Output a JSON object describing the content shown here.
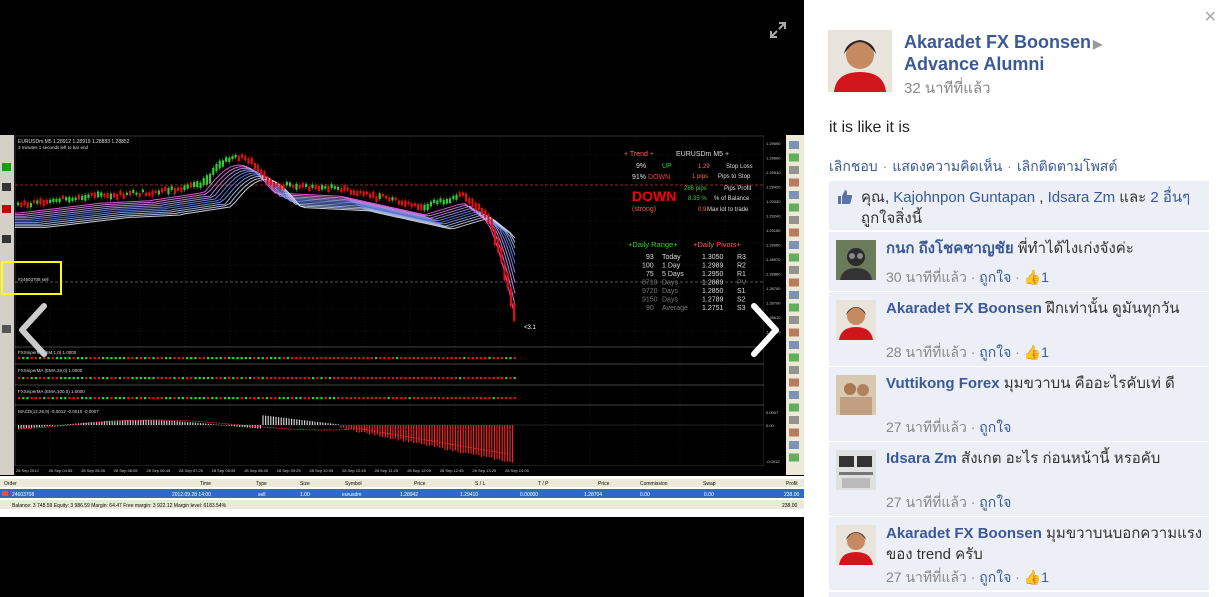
{
  "post": {
    "owner_name": "Akaradet FX Boonsen",
    "group_name": "Advance Alumni",
    "time": "32 นาทีที่แล้ว",
    "text": "it is like it is",
    "action_unlike": "เลิกชอบ",
    "action_comment": "แสดงความคิดเห็น",
    "action_unfollow": "เลิกติดตามโพสต์",
    "likes_prefix": "คุณ,",
    "like_user_1": "Kajohnpon Guntapan",
    "like_sep": ",",
    "like_user_2": "Idsara Zm",
    "likes_and": "และ",
    "likes_others": "2 อื่นๆ",
    "likes_suffix": "ถูกใจสิ่งนี้"
  },
  "comments": [
    {
      "name": "กนก ถึงโชคชาญชัย",
      "text": "พี่ทำได้ไงเก่งจังค่ะ",
      "time": "30 นาทีที่แล้ว",
      "like": "ถูกใจ",
      "count": "1"
    },
    {
      "name": "Akaradet FX Boonsen",
      "text": "ฝึกเท่านั้น ดูมันทุกวัน",
      "time": "28 นาทีที่แล้ว",
      "like": "ถูกใจ",
      "count": "1"
    },
    {
      "name": "Vuttikong Forex",
      "text": "มุมขวาบน คืออะไรคับเท่ ดี",
      "time": "27 นาทีที่แล้ว",
      "like": "ถูกใจ",
      "count": ""
    },
    {
      "name": "Idsara Zm",
      "text": "สังเกต อะไร ก่อนหน้านี้ หรอคับ",
      "time": "27 นาทีที่แล้ว",
      "like": "ถูกใจ",
      "count": ""
    },
    {
      "name": "Akaradet FX Boonsen",
      "text": "มุมขวาบนบอกความแรงของ trend ครับ",
      "time": "27 นาทีที่แล้ว",
      "like": "ถูกใจ",
      "count": "1"
    }
  ],
  "chart_image": {
    "symbol_header": "EURUSDm,M5 1.28912 1.28919 1.28883 1.28852",
    "countdown": "3 minutes 1 seconds left to bar end",
    "trend_panel": {
      "header_left": "+ Trend +",
      "header_right": "EURUSDm M5 +",
      "up_pct": "9%",
      "up_label": "UP",
      "down_pct": "91%",
      "down_label": "DOWN",
      "big_label": "DOWN",
      "strength": "(strong)",
      "sl_value": "1.29",
      "sl_label": "Stop Loss",
      "pips_stop": "1 pips",
      "pips_stop_label": "Pips to Stop",
      "pips_profit": "286 pips",
      "pips_profit_label": "Pips Profit",
      "balance_pct": "8.35 %",
      "balance_label": "% of Balance",
      "max_lot": "0.9",
      "max_lot_label": "Max lot to trade"
    },
    "daily_range_header": "+Daily Range+",
    "daily_pivots_header": "+Daily Pivots+",
    "ranges": [
      {
        "value": "93",
        "period": "Today"
      },
      {
        "value": "100",
        "period": "1 Day"
      },
      {
        "value": "75",
        "period": "5 Days"
      },
      {
        "value": "8710",
        "period": "Days"
      },
      {
        "value": "9720",
        "period": "Days"
      },
      {
        "value": "9150",
        "period": "Days"
      },
      {
        "value": "90",
        "period": "Average"
      }
    ],
    "pivots": [
      {
        "price": "1.3050",
        "label": "R3"
      },
      {
        "price": "1.2989",
        "label": "R2"
      },
      {
        "price": "1.2950",
        "label": "R1"
      },
      {
        "price": "1.2889",
        "label": "PV"
      },
      {
        "price": "1.2850",
        "label": "S1"
      },
      {
        "price": "1.2789",
        "label": "S2"
      },
      {
        "price": "1.2751",
        "label": "S3"
      }
    ],
    "price_marker": "<3.1",
    "order_label": "#24603708 sell",
    "ind1": "FXSniperMA (5M,1,0) 1.0000",
    "ind2": "FXSniperMA (EMA,25,0) 1.0000",
    "ind3": "FXSniperMA (EMA,100,0) 1.0000",
    "macd": "MACD(12,26,9) -0.0012 -0.0010 -0.0007",
    "time_axis": [
      "28 Sep 2012",
      "28 Sep 04:55",
      "28 Sep 05:35",
      "28 Sep 06:05",
      "28 Sep 06:45",
      "28 Sep 07:25",
      "28 Sep 08:05",
      "28 Sep 08:45",
      "28 Sep 09:25",
      "28 Sep 10:05",
      "28 Sep 10:45",
      "28 Sep 11:25",
      "28 Sep 12:05",
      "28 Sep 12:45",
      "28 Sep 13:25",
      "28 Sep 14:05"
    ],
    "price_axis": [
      "1.29690",
      "1.29600",
      "1.29510",
      "1.29420",
      "1.29330",
      "1.29240",
      "1.29150",
      "1.29060",
      "1.28970",
      "1.28880",
      "1.28790",
      "1.28700",
      "1.28610",
      "1.28520"
    ],
    "terminal_headers": [
      "Order",
      "Time",
      "Type",
      "Size",
      "Symbol",
      "Price",
      "S / L",
      "T / P",
      "Price",
      "Commission",
      "Swap",
      "Profit"
    ],
    "terminal_row": [
      "24603708",
      "2012.09.28 14:00",
      "sell",
      "1.00",
      "eurusdm",
      "1.28942",
      "1.29410",
      "0.00000",
      "1.28704",
      "0.00",
      "0.00",
      "238.00"
    ],
    "balance_line": "Balance: 3 748.59  Equity: 3 986.59  Margin: 64.47  Free margin: 3 922.12  Margin level: 6183.54%",
    "balance_total": "238.00"
  }
}
